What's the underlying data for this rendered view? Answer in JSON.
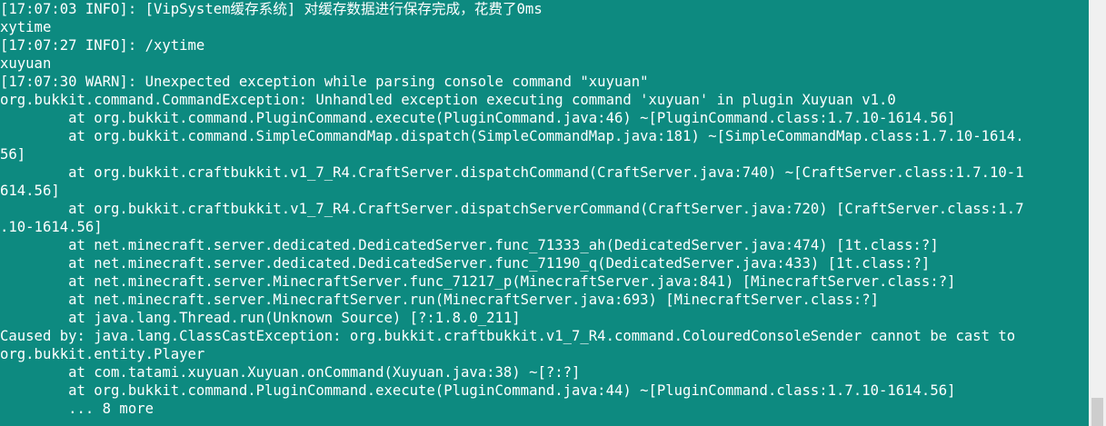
{
  "console": {
    "lines": [
      "[17:07:03 INFO]: [VipSystem缓存系统] 对缓存数据进行保存完成，花费了0ms",
      "xytime",
      "[17:07:27 INFO]: /xytime",
      "xuyuan",
      "[17:07:30 WARN]: Unexpected exception while parsing console command \"xuyuan\"",
      "org.bukkit.command.CommandException: Unhandled exception executing command 'xuyuan' in plugin Xuyuan v1.0",
      "        at org.bukkit.command.PluginCommand.execute(PluginCommand.java:46) ~[PluginCommand.class:1.7.10-1614.56]",
      "        at org.bukkit.command.SimpleCommandMap.dispatch(SimpleCommandMap.java:181) ~[SimpleCommandMap.class:1.7.10-1614.",
      "56]",
      "        at org.bukkit.craftbukkit.v1_7_R4.CraftServer.dispatchCommand(CraftServer.java:740) ~[CraftServer.class:1.7.10-1",
      "614.56]",
      "        at org.bukkit.craftbukkit.v1_7_R4.CraftServer.dispatchServerCommand(CraftServer.java:720) [CraftServer.class:1.7",
      ".10-1614.56]",
      "        at net.minecraft.server.dedicated.DedicatedServer.func_71333_ah(DedicatedServer.java:474) [1t.class:?]",
      "        at net.minecraft.server.dedicated.DedicatedServer.func_71190_q(DedicatedServer.java:433) [1t.class:?]",
      "        at net.minecraft.server.MinecraftServer.func_71217_p(MinecraftServer.java:841) [MinecraftServer.class:?]",
      "        at net.minecraft.server.MinecraftServer.run(MinecraftServer.java:693) [MinecraftServer.class:?]",
      "        at java.lang.Thread.run(Unknown Source) [?:1.8.0_211]",
      "Caused by: java.lang.ClassCastException: org.bukkit.craftbukkit.v1_7_R4.command.ColouredConsoleSender cannot be cast to",
      "org.bukkit.entity.Player",
      "        at com.tatami.xuyuan.Xuyuan.onCommand(Xuyuan.java:38) ~[?:?]",
      "        at org.bukkit.command.PluginCommand.execute(PluginCommand.java:44) ~[PluginCommand.class:1.7.10-1614.56]",
      "        ... 8 more"
    ]
  },
  "colors": {
    "background": "#0d8a80",
    "text": "#ffffff",
    "scrollbar_track": "#f0f0f0",
    "scrollbar_thumb": "#cdcdcd"
  }
}
